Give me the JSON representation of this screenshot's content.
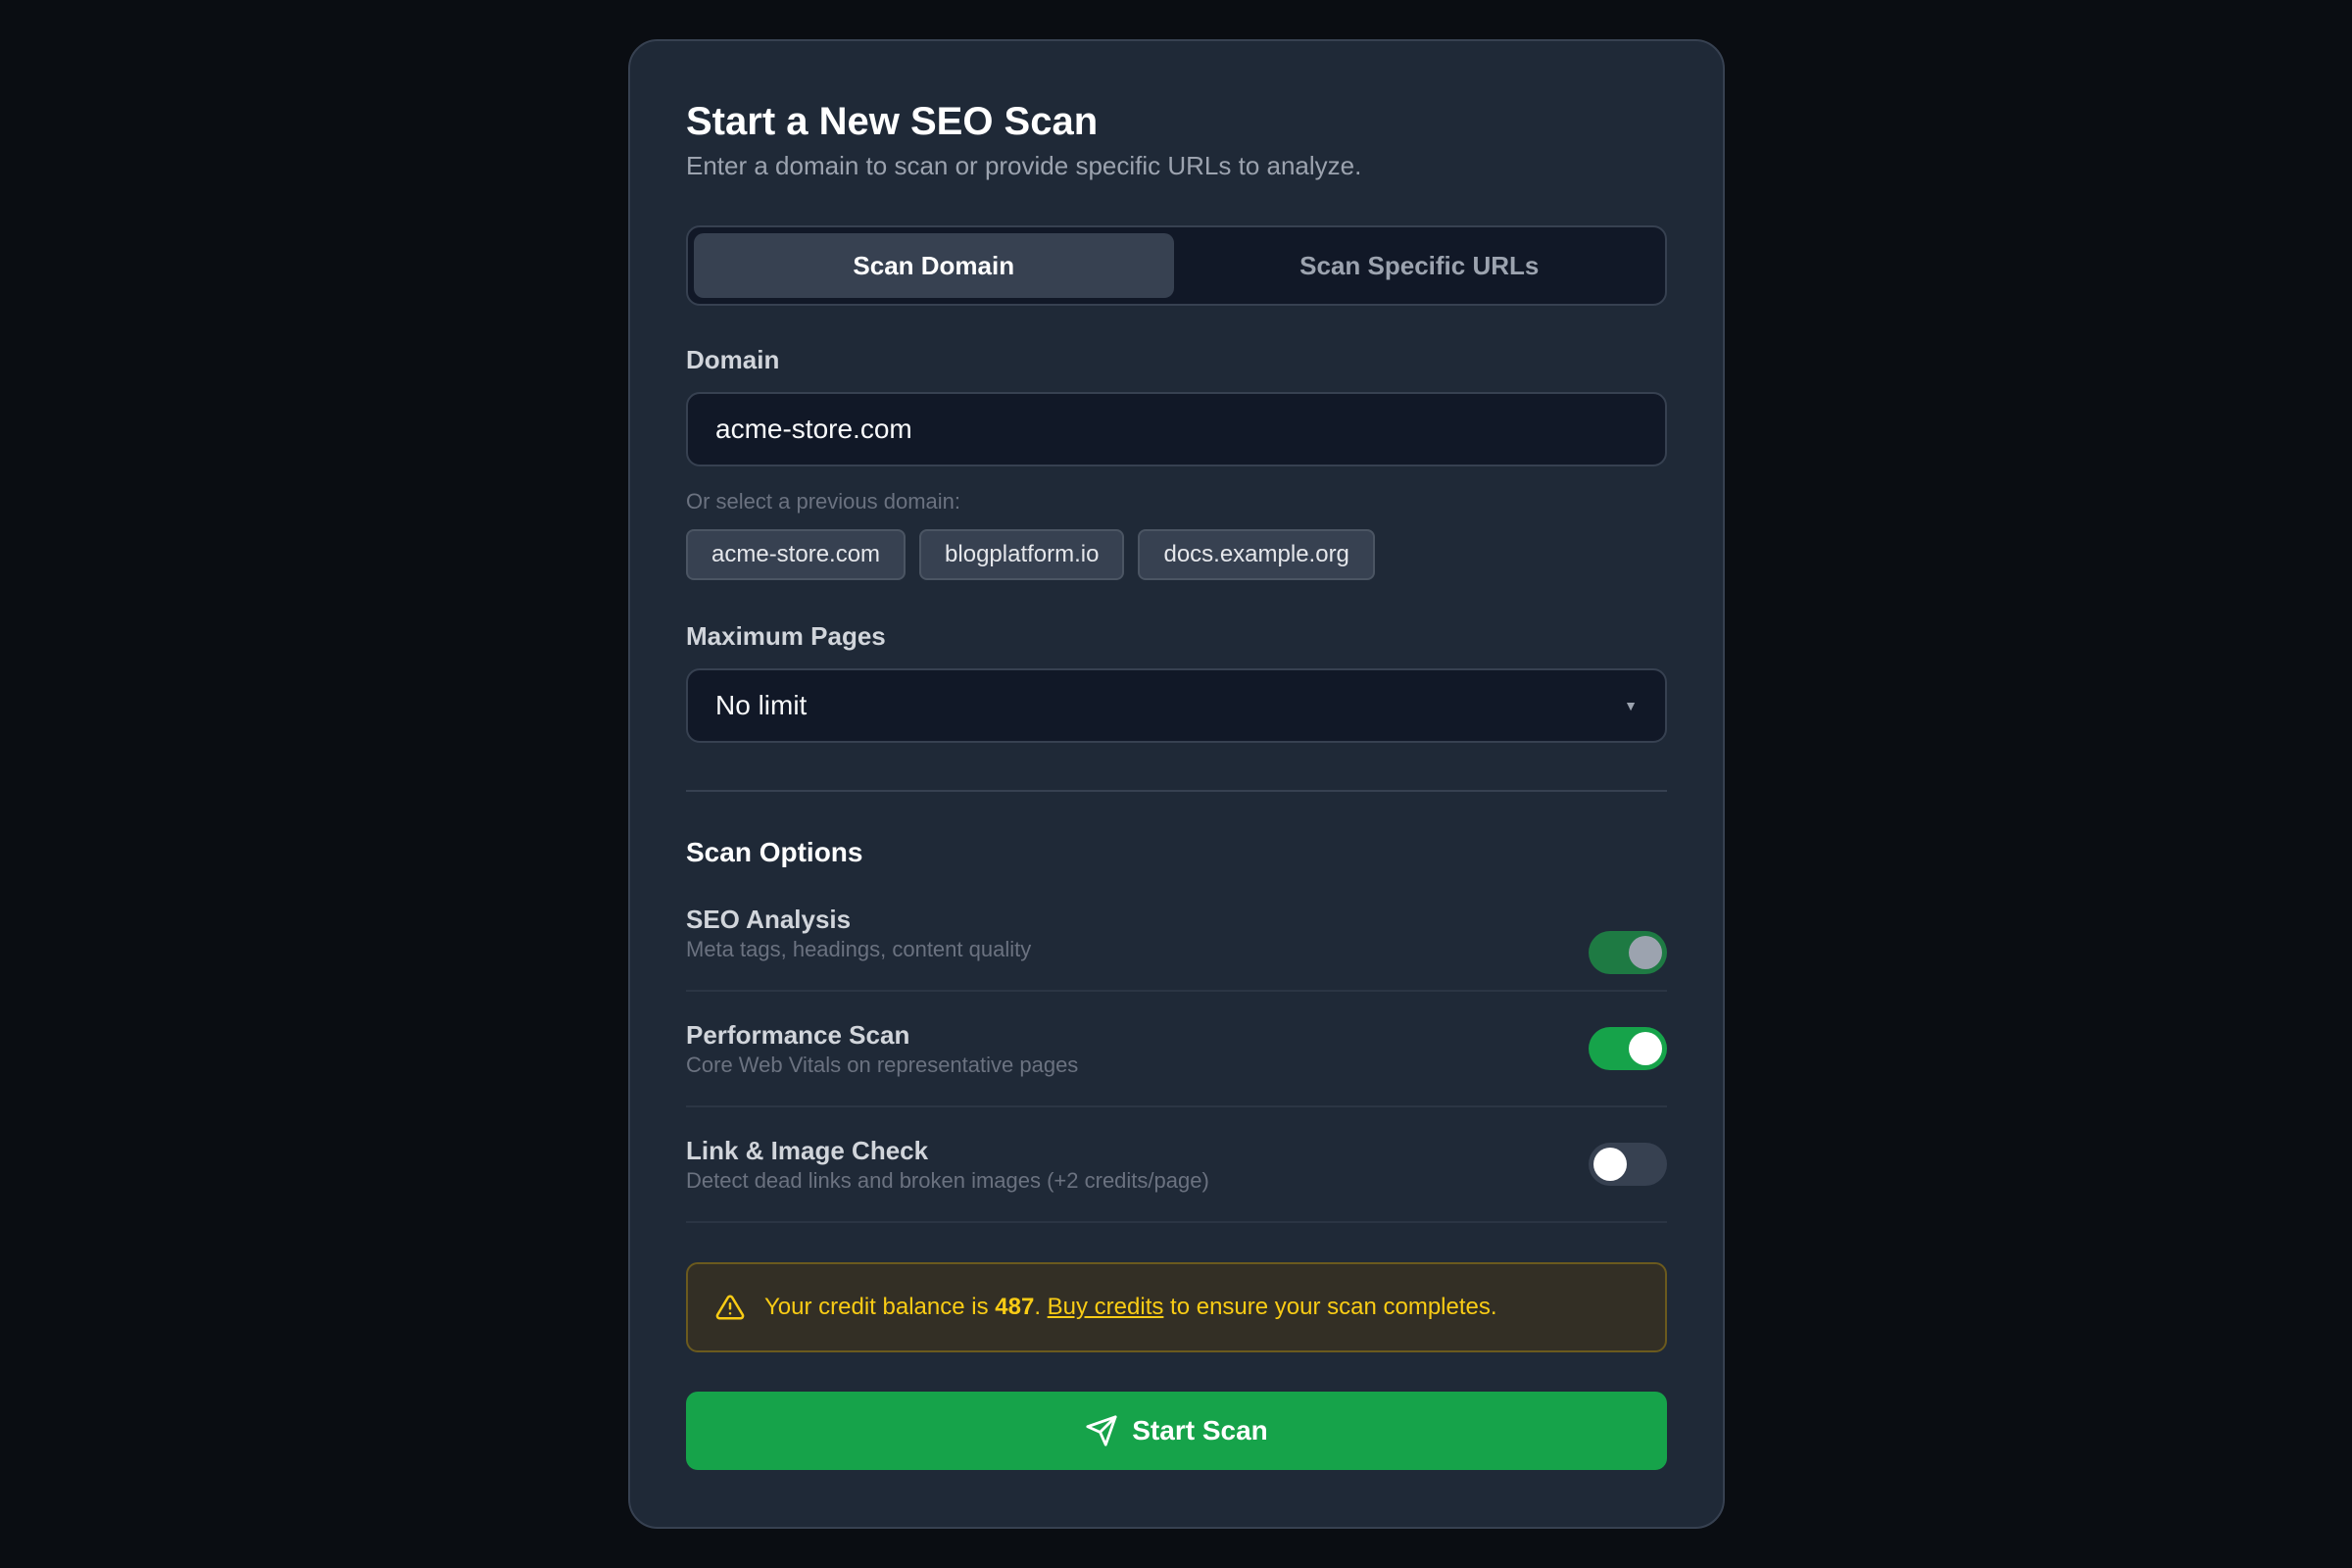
{
  "header": {
    "title": "Start a New SEO Scan",
    "subtitle": "Enter a domain to scan or provide specific URLs to analyze."
  },
  "tabs": [
    {
      "label": "Scan Domain",
      "active": true
    },
    {
      "label": "Scan Specific URLs",
      "active": false
    }
  ],
  "domain": {
    "label": "Domain",
    "value": "acme-store.com",
    "previous_hint": "Or select a previous domain:",
    "previous": [
      "acme-store.com",
      "blogplatform.io",
      "docs.example.org"
    ]
  },
  "max_pages": {
    "label": "Maximum Pages",
    "selected": "No limit"
  },
  "options": {
    "title": "Scan Options",
    "items": [
      {
        "title": "SEO Analysis",
        "description": "Meta tags, headings, content quality",
        "enabled": true,
        "disabled_look": true
      },
      {
        "title": "Performance Scan",
        "description": "Core Web Vitals on representative pages",
        "enabled": true
      },
      {
        "title": "Link & Image Check",
        "description": "Detect dead links and broken images (+2 credits/page)",
        "enabled": false
      }
    ]
  },
  "alert": {
    "prefix": "Your credit balance is ",
    "balance": "487",
    "separator": ". ",
    "link": "Buy credits",
    "suffix": " to ensure your scan completes."
  },
  "start_button": {
    "label": "Start Scan"
  },
  "colors": {
    "accent": "#16a34a",
    "warning": "#facc15",
    "card": "#1f2937",
    "background": "#0a0d12"
  }
}
